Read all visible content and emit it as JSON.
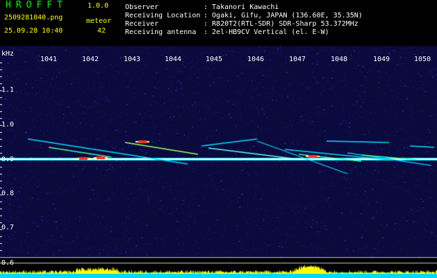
{
  "header": {
    "app_name": "HROFFT",
    "version": "1.0.0",
    "filename": "2509281040.png",
    "datetime": "25.09.28 10:40",
    "meteor_label": "meteor",
    "meteor_count": "42",
    "info_labels": [
      "Observer",
      "Receiving Location",
      "Receiver",
      "Receiving antenna"
    ],
    "info_values": [
      ": Takanori Kawachi",
      ": Ogaki, Gifu, JAPAN (136.60E, 35.35N)",
      ": R820T2(RTL-SDR) SDR-Sharp 53.372MHz",
      ": 2el-HB9CV Vertical (el. E-W)"
    ]
  },
  "spectrogram": {
    "unit_label": "kHz",
    "time_ticks": [
      "1041",
      "1042",
      "1043",
      "1044",
      "1045",
      "1046",
      "1047",
      "1048",
      "1049",
      "1050"
    ],
    "freq_ticks": [
      "1.1",
      "1.0",
      "0.9",
      "0.8",
      "0.7",
      "0.6"
    ],
    "colors": {
      "background": "#0a0a3c",
      "text": "#ffffff",
      "title": "#00ff00",
      "highlight": "#ffff00",
      "signal_hot": "#ff3030",
      "signal_cyan": "#00e0ff",
      "bar_base": "#00d8ff"
    }
  }
}
